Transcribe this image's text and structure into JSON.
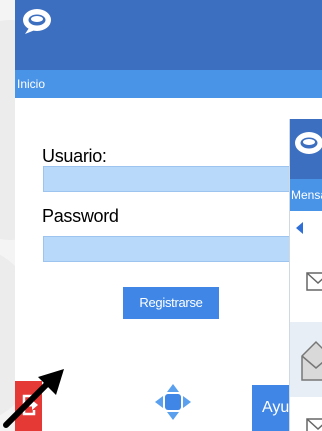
{
  "main": {
    "nav_title": "Inicio",
    "form": {
      "user_label": "Usuario:",
      "user_value": "",
      "password_label": "Password",
      "password_value": "",
      "register_label": "Registrarse"
    },
    "bottom": {
      "help_label": "Ayuda",
      "exit_icon": "exit-icon",
      "dpad_icon": "dpad-icon"
    }
  },
  "second_window": {
    "nav_title": "Mensajes"
  },
  "colors": {
    "header_blue": "#3d6fc0",
    "nav_blue": "#4a94e8",
    "input_fill": "#b9d9fb",
    "button_blue": "#3f86e6",
    "exit_red": "#e53935"
  }
}
